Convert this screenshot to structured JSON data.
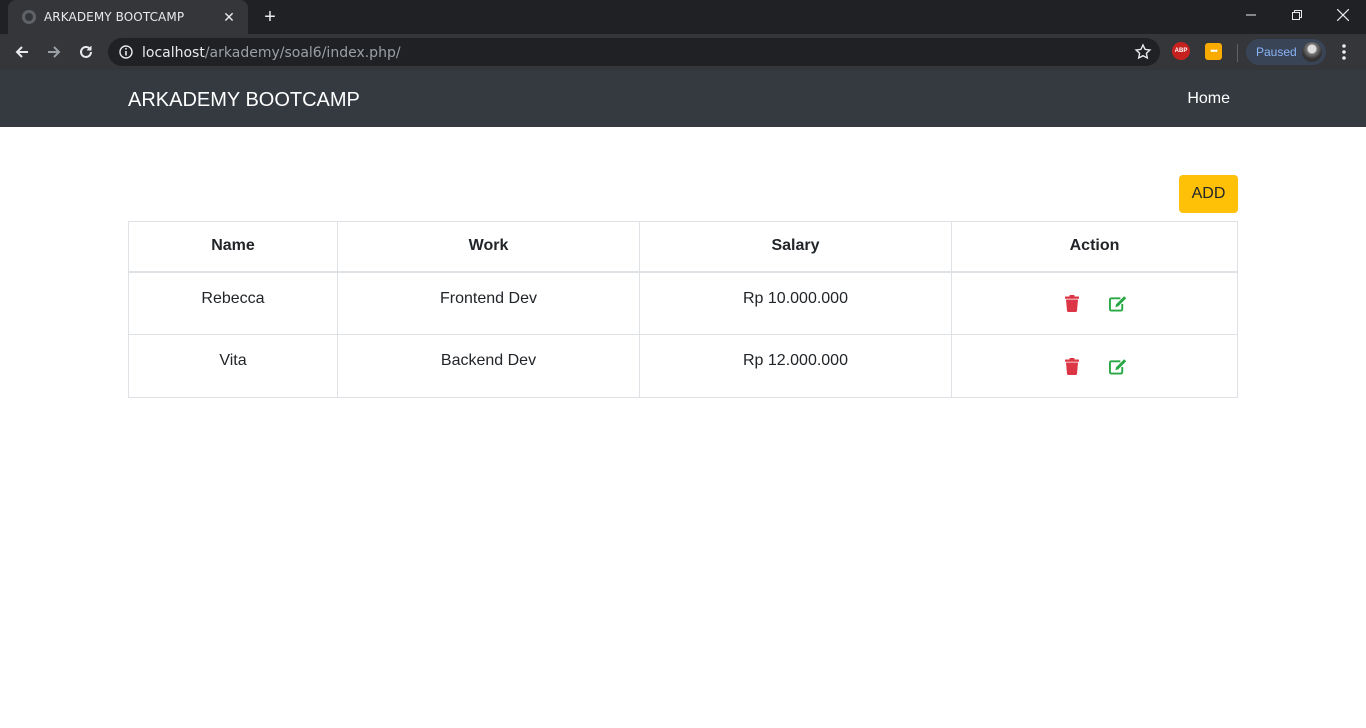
{
  "browser": {
    "tab_title": "ARKADEMY BOOTCAMP",
    "url_host": "localhost",
    "url_path": "/arkademy/soal6/index.php/",
    "abp_label": "ABP",
    "profile_status": "Paused"
  },
  "navbar": {
    "brand": "ARKADEMY BOOTCAMP",
    "home_label": "Home"
  },
  "actions": {
    "add_label": "ADD"
  },
  "table": {
    "headers": [
      "Name",
      "Work",
      "Salary",
      "Action"
    ],
    "rows": [
      {
        "name": "Rebecca",
        "work": "Frontend Dev",
        "salary": "Rp 10.000.000"
      },
      {
        "name": "Vita",
        "work": "Backend Dev",
        "salary": "Rp 12.000.000"
      }
    ]
  },
  "colors": {
    "navbar_bg": "#343a40",
    "add_button": "#ffc107",
    "delete_icon": "#dc3545",
    "edit_icon": "#28a745"
  }
}
